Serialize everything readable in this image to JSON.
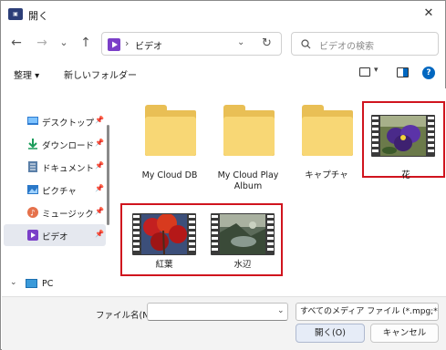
{
  "window": {
    "title": "開く",
    "app_icon": "app-icon",
    "close_glyph": "✕"
  },
  "nav": {
    "back": "←",
    "forward": "→",
    "recent": "⌄",
    "up": "↑",
    "path_separator": "›",
    "current_folder": "ビデオ",
    "dropdown": "⌄",
    "refresh": "↻",
    "search_placeholder": "ビデオの検索"
  },
  "toolbar": {
    "organize": "整理 ▾",
    "new_folder": "新しいフォルダー",
    "view_dropdown": "▾",
    "help": "?"
  },
  "sidebar": {
    "items": [
      {
        "label": "デスクトップ",
        "icon": "desktop-icon",
        "pin": "📌"
      },
      {
        "label": "ダウンロード",
        "icon": "download-icon",
        "pin": "📌"
      },
      {
        "label": "ドキュメント",
        "icon": "document-icon",
        "pin": "📌"
      },
      {
        "label": "ピクチャ",
        "icon": "pictures-icon",
        "pin": "📌"
      },
      {
        "label": "ミュージック",
        "icon": "music-icon",
        "pin": "📌"
      },
      {
        "label": "ビデオ",
        "icon": "video-icon",
        "pin": "📌",
        "active": true
      }
    ],
    "pc": {
      "chevron": "⌄",
      "label": "PC"
    }
  },
  "files": {
    "items": [
      {
        "label": "My Cloud DB",
        "type": "folder"
      },
      {
        "label": "My Cloud Play Album",
        "type": "folder"
      },
      {
        "label": "キャプチャ",
        "type": "folder"
      },
      {
        "label": "花",
        "type": "video",
        "highlighted": true
      },
      {
        "label": "紅葉",
        "type": "video",
        "highlighted": true
      },
      {
        "label": "水辺",
        "type": "video",
        "highlighted": true
      }
    ],
    "highlight_color": "#d0141e"
  },
  "footer": {
    "filename_label": "ファイル名(N):",
    "filename_value": "",
    "filename_dropdown": "⌄",
    "filetype": "すべてのメディア ファイル (*.mpg;*.m",
    "open_button": "開く(O)",
    "cancel_button": "キャンセル"
  },
  "colors": {
    "accent": "#0067c0",
    "folder": "#f8d775",
    "selected_bg": "#e5e8ef"
  }
}
